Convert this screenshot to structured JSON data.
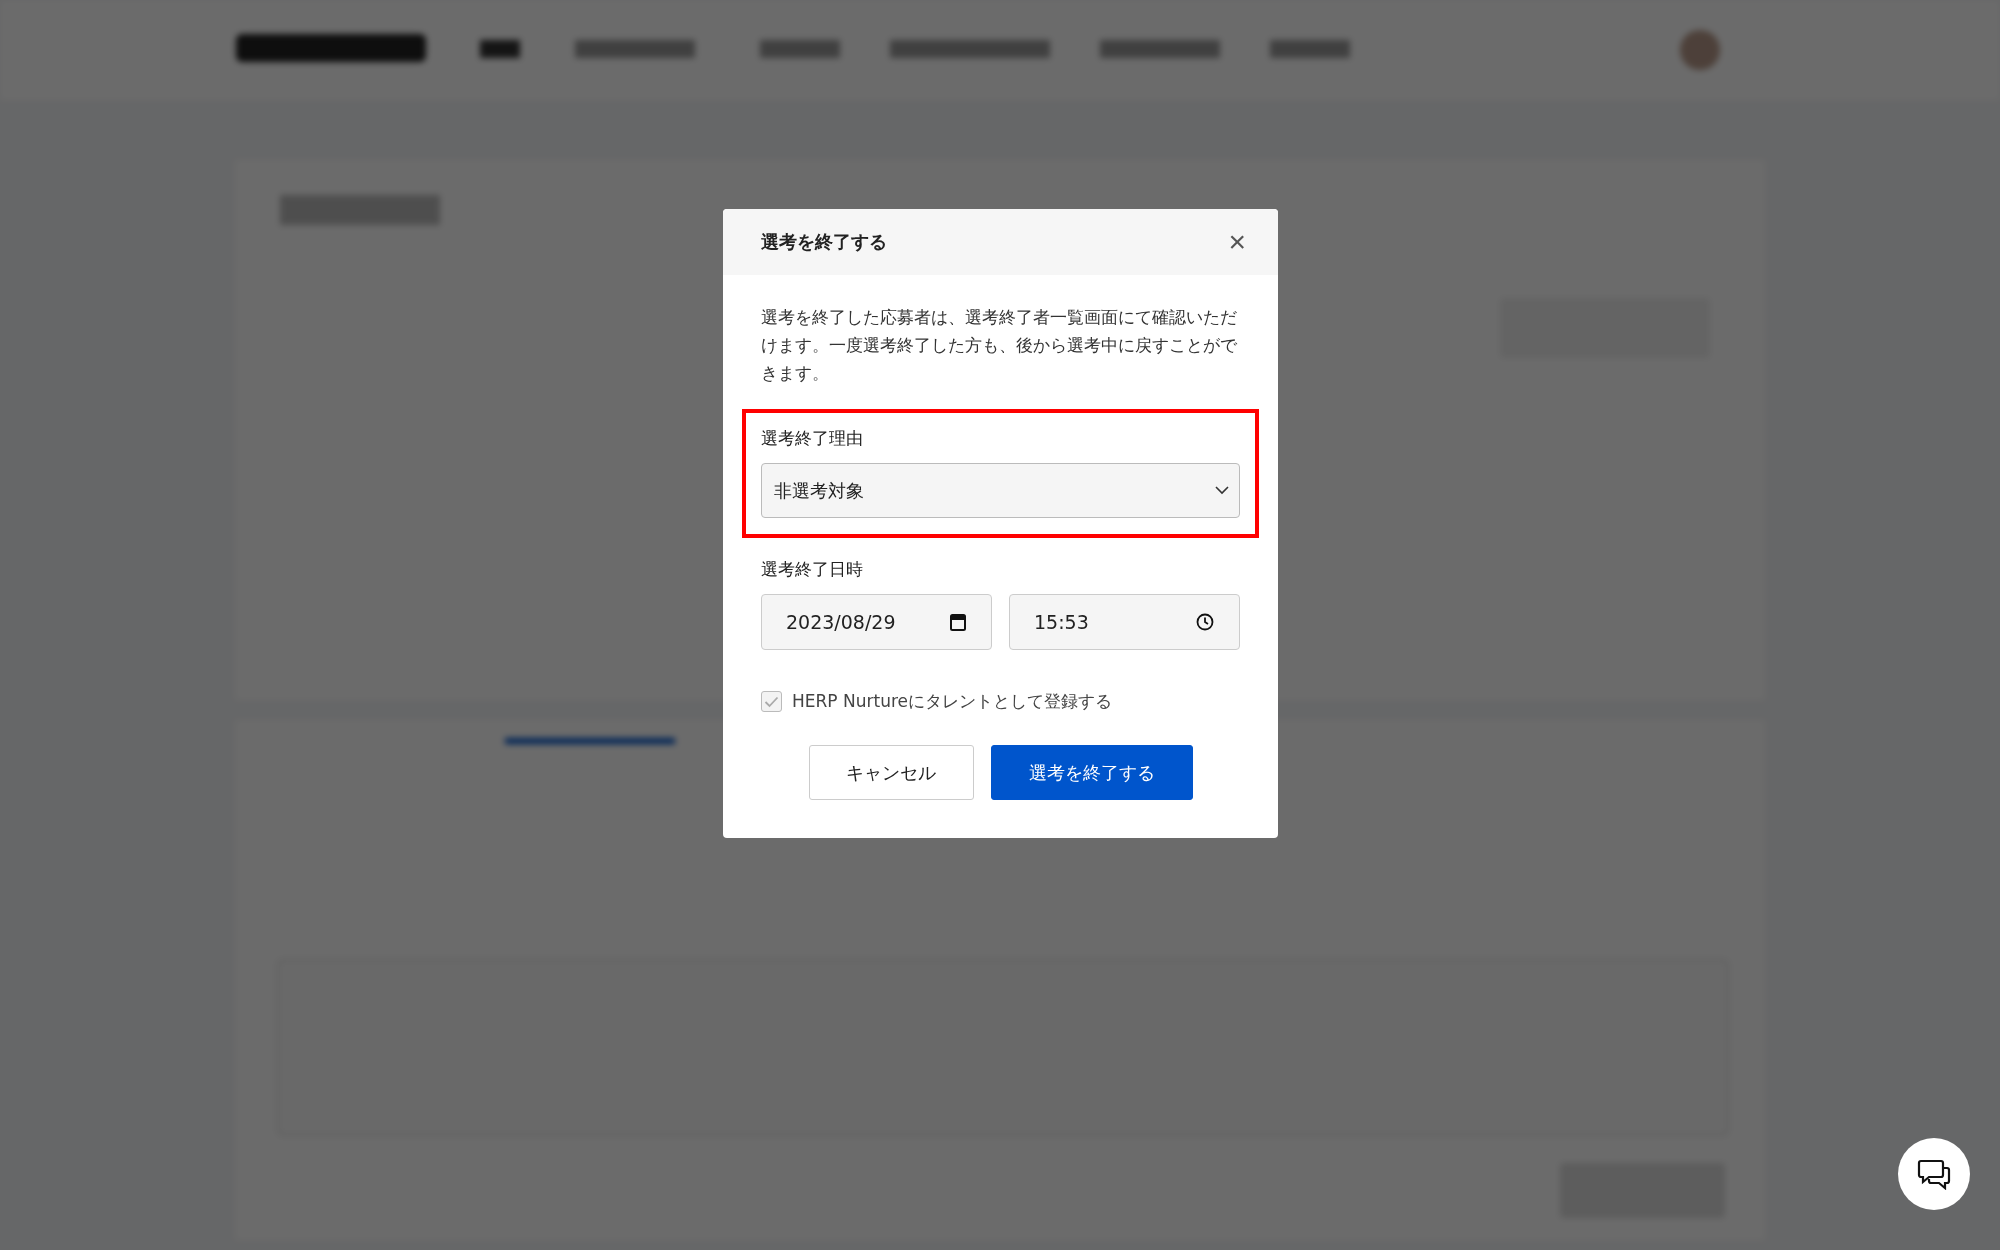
{
  "dialog": {
    "title": "選考を終了する",
    "close": "×",
    "description": "選考を終了した応募者は、選考終了者一覧画面にて確認いただけます。一度選考終了した方も、後から選考中に戻すことができます。",
    "reason": {
      "label": "選考終了理由",
      "value": "非選考対象"
    },
    "datetime": {
      "label": "選考終了日時",
      "date": "2023/08/29",
      "time": "15:53"
    },
    "nurture": {
      "label": "HERP Nurtureにタレントとして登録する",
      "checked": true,
      "disabled": true
    },
    "buttons": [
      {
        "label": "キャンセル",
        "kind": "secondary"
      },
      {
        "label": "選考を終了する",
        "kind": "primary"
      }
    ]
  }
}
